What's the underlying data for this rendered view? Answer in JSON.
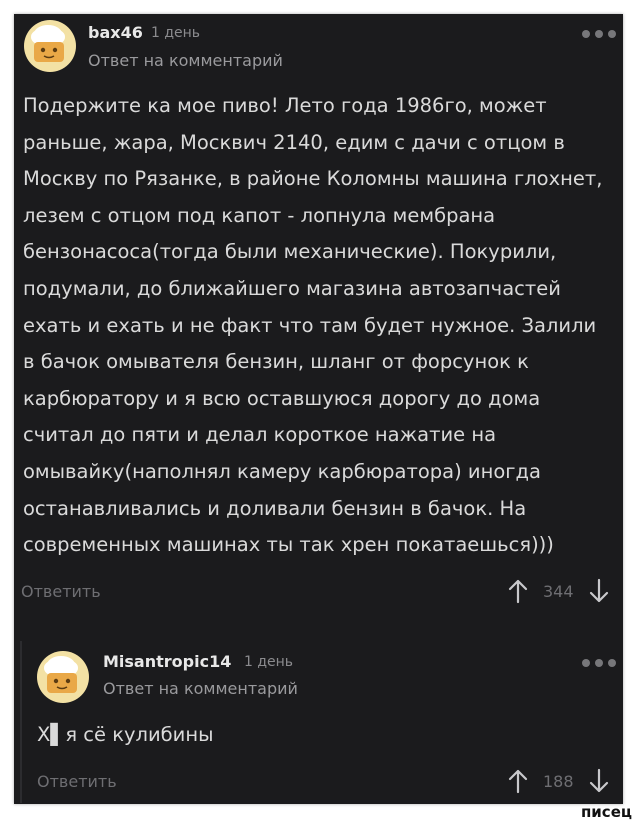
{
  "comment": {
    "username": "bax46",
    "time": "1 день",
    "reply_to": "Ответ на комментарий",
    "text": "Подержите ка мое пиво! Лето года 1986го, может раньше, жара, Москвич 2140, едим с дачи с отцом в Москву по Рязанке, в районе Коломны машина глохнет, лезем с отцом под капот - лопнула мембрана бензонасоса(тогда были механические). Покурили, подумали, до ближайшего магазина автозапчастей ехать и ехать и не факт что там будет нужное. Залили в бачок омывателя бензин, шланг от форсунок к карбюратору и я всю оставшуюся дорогу до дома считал до пяти и делал короткое нажатие на омывайку(наполнял камеру карбюратора) иногда останавливались и доливали бензин в бачок. На современных машинах ты так хрен покатаешься)))",
    "reply_label": "Ответить",
    "score": "344"
  },
  "reply": {
    "username": "Misantropic14",
    "time": "1 день",
    "reply_to": "Ответ на комментарий",
    "text": "Х▌я сё кулибины",
    "reply_label": "Ответить",
    "score": "188"
  },
  "watermark": "писец",
  "colors": {
    "background": "#1b1b1d",
    "text": "#dadada",
    "muted": "#6e6e72",
    "avatar": "#f3e1a4"
  },
  "icons": [
    "avatar-icon",
    "more-dots-icon",
    "upvote-arrow-icon",
    "downvote-arrow-icon"
  ]
}
